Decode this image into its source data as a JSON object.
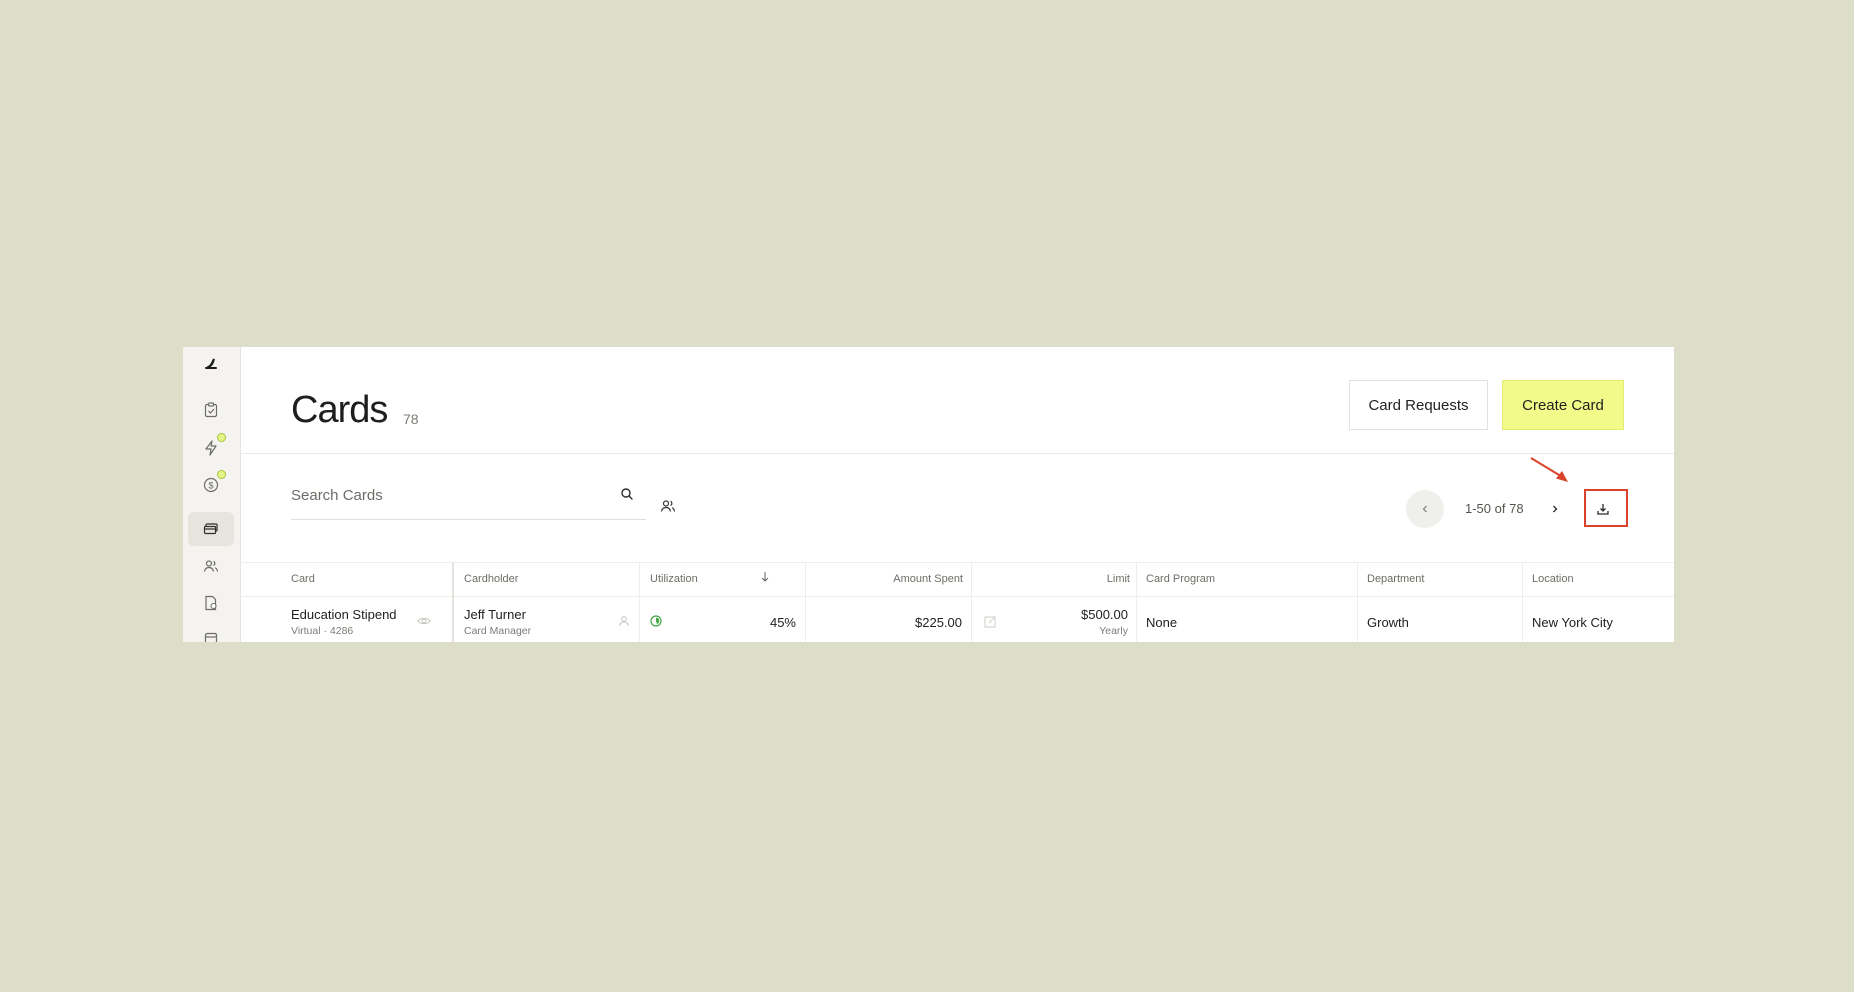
{
  "page": {
    "title": "Cards",
    "count": "78"
  },
  "buttons": {
    "card_requests": "Card Requests",
    "create_card": "Create Card"
  },
  "search": {
    "placeholder": "Search Cards"
  },
  "pager": {
    "text": "1-50 of 78"
  },
  "table": {
    "headers": {
      "card": "Card",
      "cardholder": "Cardholder",
      "utilization": "Utilization",
      "amount_spent": "Amount Spent",
      "limit": "Limit",
      "card_program": "Card Program",
      "department": "Department",
      "location": "Location"
    },
    "rows": [
      {
        "card_name": "Education Stipend",
        "card_meta": "Virtual · 4286",
        "cardholder_name": "Jeff Turner",
        "cardholder_role": "Card Manager",
        "utilization": "45%",
        "utilization_fraction": 0.45,
        "amount_spent": "$225.00",
        "limit": "$500.00",
        "limit_period": "Yearly",
        "card_program": "None",
        "department": "Growth",
        "location": "New York City"
      }
    ]
  },
  "colors": {
    "background": "#dcdeca",
    "create_accent": "#f2fb8a",
    "highlight": "#d9432b",
    "utilization_green": "#3fa63f",
    "notification_dot": "#e6f58a"
  },
  "icons": {
    "sidebar": [
      "logo-icon",
      "checklist-icon",
      "bolt-icon",
      "dollar-icon",
      "cards-icon",
      "people-icon",
      "document-icon",
      "calendar-icon"
    ],
    "toolbar": [
      "search-icon",
      "people-filter-icon",
      "chevron-left-icon",
      "chevron-right-icon",
      "download-icon"
    ]
  }
}
